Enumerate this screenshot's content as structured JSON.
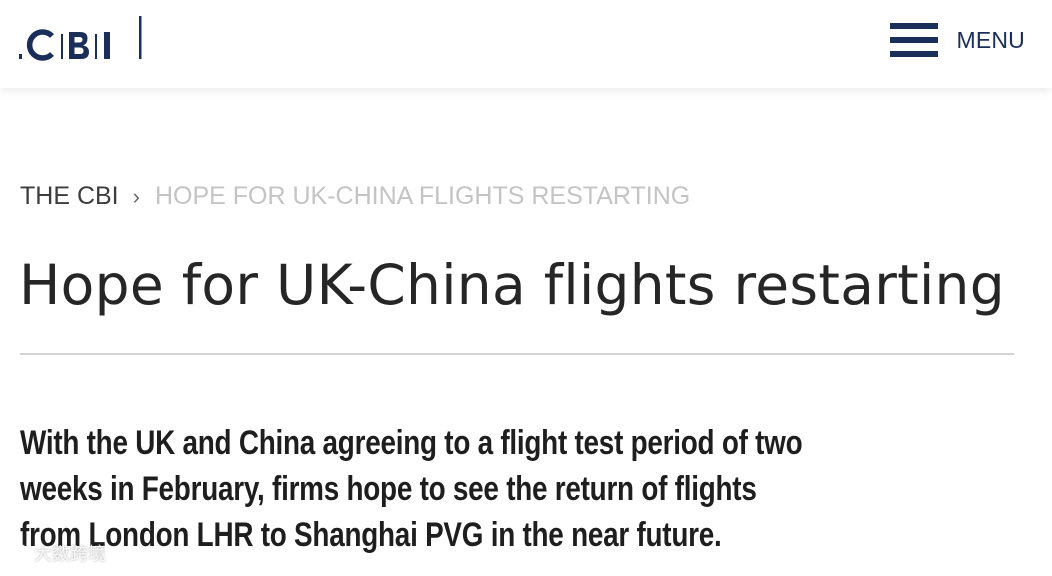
{
  "header": {
    "logo_text": "CBI",
    "menu_label": "MENU",
    "brand_color": "#1b2d59"
  },
  "breadcrumb": {
    "home": "THE CBI",
    "separator": "›",
    "current": "HOPE FOR UK-CHINA FLIGHTS RESTARTING"
  },
  "article": {
    "title": "Hope for UK-China flights restarting",
    "lead": "With the UK and China agreeing to a flight test period of two weeks in February, firms hope to see the return of flights from London LHR to Shanghai PVG in the near future."
  },
  "watermark": {
    "text": "大数跨境"
  }
}
